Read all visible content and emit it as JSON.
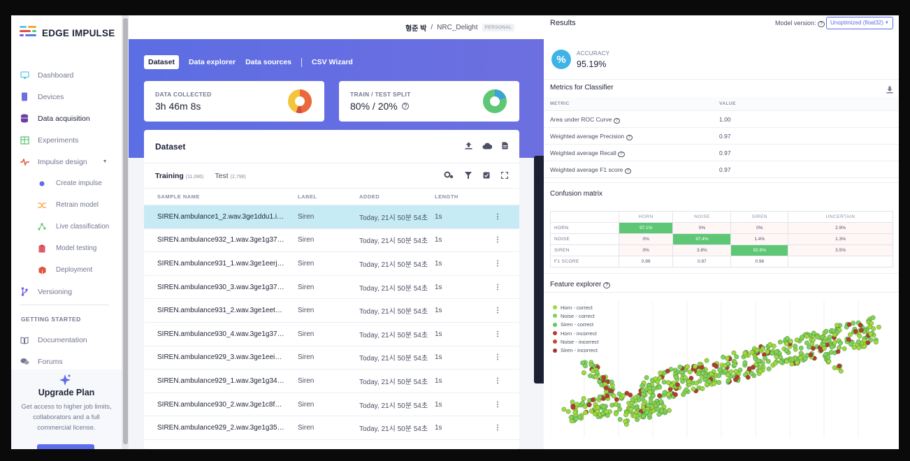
{
  "app": {
    "name": "EDGE IMPULSE"
  },
  "colors": {
    "accent": "#5d6ce8",
    "correct_dot": "#7fd35a",
    "incorrect_dot": "#b63a2e",
    "highlight": "#5ec775",
    "selected_row": "#c6ebf5"
  },
  "sidebar": {
    "items": [
      {
        "label": "Dashboard",
        "icon": "monitor-icon"
      },
      {
        "label": "Devices",
        "icon": "device-icon"
      },
      {
        "label": "Data acquisition",
        "icon": "database-icon"
      },
      {
        "label": "Experiments",
        "icon": "table-icon"
      },
      {
        "label": "Impulse design",
        "icon": "pulse-icon"
      }
    ],
    "sub_items": [
      {
        "label": "Create impulse",
        "icon": "circle-icon"
      },
      {
        "label": "Retrain model",
        "icon": "shuffle-icon"
      },
      {
        "label": "Live classification",
        "icon": "graph-icon"
      },
      {
        "label": "Model testing",
        "icon": "clipboard-icon"
      },
      {
        "label": "Deployment",
        "icon": "package-icon"
      }
    ],
    "versioning": "Versioning",
    "section_label": "GETTING STARTED",
    "help": [
      {
        "label": "Documentation",
        "icon": "book-icon"
      },
      {
        "label": "Forums",
        "icon": "chat-icon"
      }
    ],
    "upgrade": {
      "title": "Upgrade Plan",
      "text": "Get access to higher job limits, collaborators and a full commercial license."
    }
  },
  "header": {
    "user": "형준 박",
    "separator": "/",
    "project": "NRC_Delight",
    "badge": "PERSONAL"
  },
  "tabs": [
    "Dataset",
    "Data explorer",
    "Data sources",
    "CSV Wizard"
  ],
  "stats": {
    "collected_label": "DATA COLLECTED",
    "collected_value": "3h 46m 8s",
    "split_label": "TRAIN / TEST SPLIT",
    "split_value": "80% / 20%"
  },
  "dataset": {
    "title": "Dataset",
    "training_label": "Training",
    "training_count": "(11,086)",
    "test_label": "Test",
    "test_count": "(2,798)",
    "columns": [
      "SAMPLE NAME",
      "LABEL",
      "ADDED",
      "LENGTH"
    ],
    "rows": [
      {
        "name": "SIREN.ambulance1_2.wav.3ge1ddu1.in...",
        "label": "Siren",
        "added": "Today, 21시 50분 54초",
        "length": "1s"
      },
      {
        "name": "SIREN.ambulance932_1.wav.3ge1g37e.i...",
        "label": "Siren",
        "added": "Today, 21시 50분 54초",
        "length": "1s"
      },
      {
        "name": "SIREN.ambulance931_1.wav.3ge1eerj.i...",
        "label": "Siren",
        "added": "Today, 21시 50분 54초",
        "length": "1s"
      },
      {
        "name": "SIREN.ambulance930_3.wav.3ge1g377.i...",
        "label": "Siren",
        "added": "Today, 21시 50분 54초",
        "length": "1s"
      },
      {
        "name": "SIREN.ambulance931_2.wav.3ge1eetb.i...",
        "label": "Siren",
        "added": "Today, 21시 50분 54초",
        "length": "1s"
      },
      {
        "name": "SIREN.ambulance930_4.wav.3ge1g376.i...",
        "label": "Siren",
        "added": "Today, 21시 50분 54초",
        "length": "1s"
      },
      {
        "name": "SIREN.ambulance929_3.wav.3ge1eei0.i...",
        "label": "Siren",
        "added": "Today, 21시 50분 54초",
        "length": "1s"
      },
      {
        "name": "SIREN.ambulance929_1.wav.3ge1g349.i...",
        "label": "Siren",
        "added": "Today, 21시 50분 54초",
        "length": "1s"
      },
      {
        "name": "SIREN.ambulance930_2.wav.3ge1c8fm.i...",
        "label": "Siren",
        "added": "Today, 21시 50분 54초",
        "length": "1s"
      },
      {
        "name": "SIREN.ambulance929_2.wav.3ge1g35a.i...",
        "label": "Siren",
        "added": "Today, 21시 50분 54초",
        "length": "1s"
      }
    ]
  },
  "results": {
    "title": "Results",
    "model_version_label": "Model version:",
    "model_version_value": "Unoptimized (float32)",
    "accuracy_label": "ACCURACY",
    "accuracy_value": "95.19%",
    "metrics_title": "Metrics for Classifier",
    "metrics_header": [
      "METRIC",
      "VALUE"
    ],
    "metrics": [
      {
        "name": "Area under ROC Curve",
        "value": "1.00"
      },
      {
        "name": "Weighted average Precision",
        "value": "0.97"
      },
      {
        "name": "Weighted average Recall",
        "value": "0.97"
      },
      {
        "name": "Weighted average F1 score",
        "value": "0.97"
      }
    ],
    "confusion_title": "Confusion matrix",
    "confusion_cols": [
      "HORN",
      "NOISE",
      "SIREN",
      "UNCERTAIN"
    ],
    "confusion_rows": [
      {
        "label": "HORN",
        "cells": [
          "97.1%",
          "0%",
          "0%",
          "2.9%"
        ]
      },
      {
        "label": "NOISE",
        "cells": [
          "0%",
          "97.4%",
          "1.4%",
          "1.3%"
        ]
      },
      {
        "label": "SIREN",
        "cells": [
          "0%",
          "3.8%",
          "92.8%",
          "3.5%"
        ]
      },
      {
        "label": "F1 SCORE",
        "cells": [
          "0.99",
          "0.97",
          "0.96",
          ""
        ]
      }
    ],
    "feature_title": "Feature explorer",
    "legend": [
      {
        "label": "Horn - correct",
        "color": "#9fd93e"
      },
      {
        "label": "Noise - correct",
        "color": "#7fd35a"
      },
      {
        "label": "Siren - correct",
        "color": "#5ec766"
      },
      {
        "label": "Horn - incorrect",
        "color": "#b63a2e"
      },
      {
        "label": "Noise - incorrect",
        "color": "#c24a3a"
      },
      {
        "label": "Siren - incorrect",
        "color": "#a3312a"
      }
    ]
  }
}
